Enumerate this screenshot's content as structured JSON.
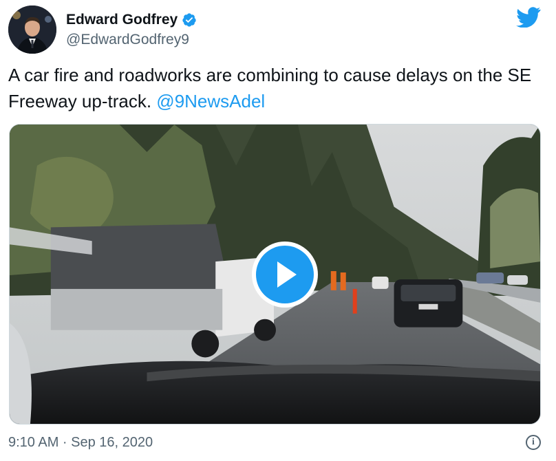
{
  "author": {
    "display_name": "Edward Godfrey",
    "handle": "@EdwardGodfrey9",
    "verified": true
  },
  "tweet": {
    "text_before_mention": "A car fire and roadworks are combining to cause delays on the SE Freeway up-track. ",
    "mention": "@9NewsAdel"
  },
  "media": {
    "kind": "video",
    "play_icon": "play-icon"
  },
  "footer": {
    "timestamp": "9:10 AM · Sep 16, 2020",
    "info_icon": "info-icon"
  },
  "icons": {
    "brand": "twitter-bird-icon",
    "verified": "verified-badge-icon"
  },
  "colors": {
    "accent": "#1d9bf0",
    "text_primary": "#0f1419",
    "text_secondary": "#536471"
  }
}
